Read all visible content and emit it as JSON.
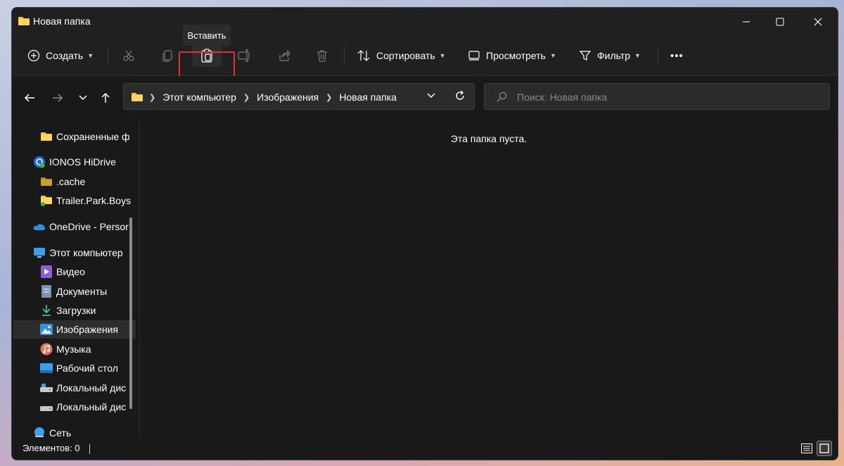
{
  "window": {
    "title": "Новая папка"
  },
  "toolbar": {
    "create_label": "Создать",
    "sort_label": "Сортировать",
    "view_label": "Просмотреть",
    "filter_label": "Фильтр",
    "more_label": "•••",
    "paste_tooltip": "Вставить",
    "icons": [
      "plus-circle-icon",
      "scissors-icon",
      "copy-icon",
      "paste-icon",
      "rename-icon",
      "share-icon",
      "trash-icon",
      "sort-icon",
      "view-icon",
      "filter-icon",
      "more-icon"
    ]
  },
  "navigation": {
    "breadcrumbs": [
      "Этот компьютер",
      "Изображения",
      "Новая папка"
    ],
    "search_placeholder": "Поиск: Новая папка"
  },
  "sidebar": {
    "items": [
      {
        "label": "Сохраненные ф",
        "icon": "folder-icon"
      },
      {
        "label": "IONOS HiDrive",
        "icon": "cloud-drive-icon"
      },
      {
        "label": ".cache",
        "icon": "folder-icon"
      },
      {
        "label": "Trailer.Park.Boys",
        "icon": "folder-icon"
      },
      {
        "label": "OneDrive - Persor",
        "icon": "onedrive-icon"
      },
      {
        "label": "Этот компьютер",
        "icon": "computer-icon"
      },
      {
        "label": "Видео",
        "icon": "video-icon"
      },
      {
        "label": "Документы",
        "icon": "documents-icon"
      },
      {
        "label": "Загрузки",
        "icon": "download-icon"
      },
      {
        "label": "Изображения",
        "icon": "pictures-icon"
      },
      {
        "label": "Музыка",
        "icon": "music-icon"
      },
      {
        "label": "Рабочий стол",
        "icon": "desktop-icon"
      },
      {
        "label": "Локальный дис",
        "icon": "drive-icon"
      },
      {
        "label": "Локальный дис",
        "icon": "drive-icon"
      },
      {
        "label": "Сеть",
        "icon": "network-icon"
      }
    ],
    "selected_index": 9
  },
  "content": {
    "empty_message": "Эта папка пуста."
  },
  "status": {
    "items_count": "Элементов: 0"
  },
  "colors": {
    "background": "#191919",
    "toolbar": "#202020",
    "highlight": "#e03232",
    "accent": "#60cdff"
  }
}
